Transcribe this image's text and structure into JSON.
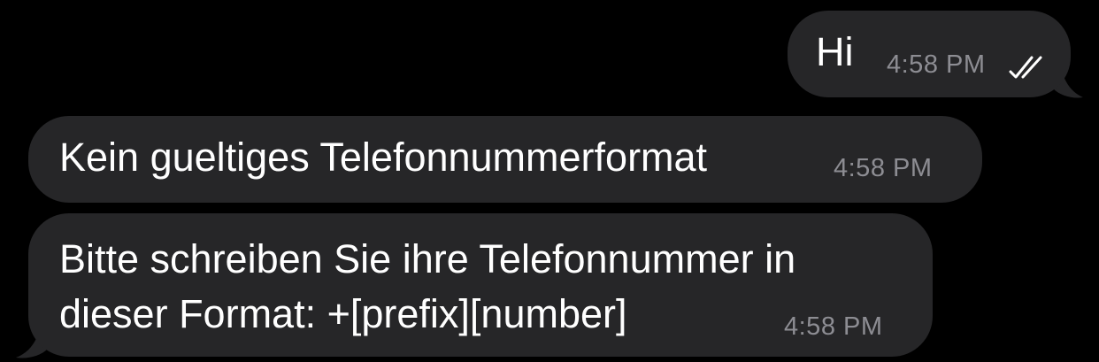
{
  "colors": {
    "background": "#000000",
    "bubble": "#262628",
    "text": "#ffffff",
    "timestamp": "#8d8d93"
  },
  "messages": [
    {
      "direction": "outgoing",
      "lines": [
        "Hi"
      ],
      "time": "4:58 PM",
      "status_icon": "double-check-icon"
    },
    {
      "direction": "incoming",
      "lines": [
        "Kein gueltiges Telefonnummerformat"
      ],
      "time": "4:58 PM"
    },
    {
      "direction": "incoming",
      "lines": [
        "Bitte schreiben Sie ihre Telefonnummer in",
        "dieser Format: +[prefix][number]"
      ],
      "time": "4:58 PM"
    }
  ]
}
